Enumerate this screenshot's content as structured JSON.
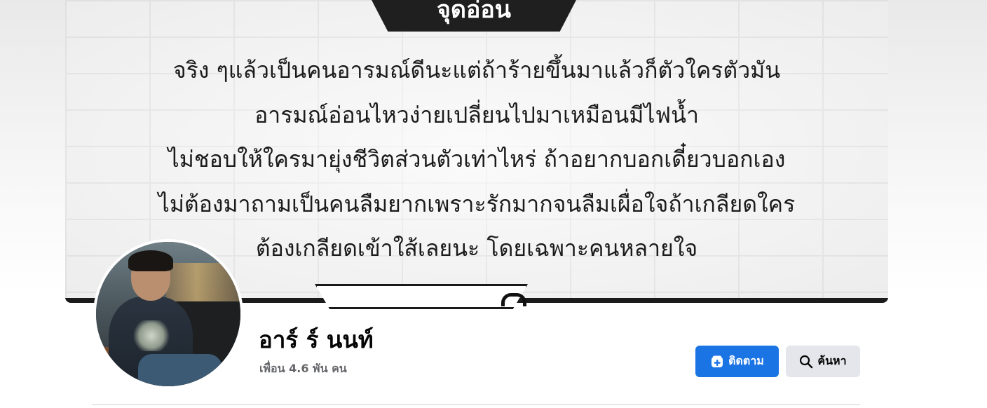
{
  "cover": {
    "heading": "จุดอ่อน",
    "lines": [
      "จริง ๆแล้วเป็นคนอารมณ์ดีนะแต่ถ้าร้ายขึ้นมาแล้วก็ตัวใครตัวมัน",
      "อารมณ์อ่อนไหวง่ายเปลี่ยนไปมาเหมือนมีไฟน้ำ",
      "ไม่ชอบให้ใครมายุ่งชีวิตส่วนตัวเท่าไหร่  ถ้าอยากบอกเดี๋ยวบอกเอง",
      "ไม่ต้องมาถามเป็นคนลืมยากเพราะรักมากจนลืมเผื่อใจถ้าเกลียดใคร",
      "ต้องเกลียดเข้าใส้เลยนะ  โดยเฉพาะคนหลายใจ"
    ]
  },
  "profile": {
    "name": "อาร์ ร์ นนท์",
    "friends": "เพื่อน 4.6 พัน คน"
  },
  "actions": {
    "follow_label": "ติดตาม",
    "follow_icon": "follow-plus-icon",
    "search_label": "ค้นหา",
    "search_icon": "search-icon"
  },
  "colors": {
    "primary_button": "#1b74e4",
    "secondary_button": "#e4e6eb",
    "name_text": "#050505",
    "secondary_text": "#65676b"
  }
}
